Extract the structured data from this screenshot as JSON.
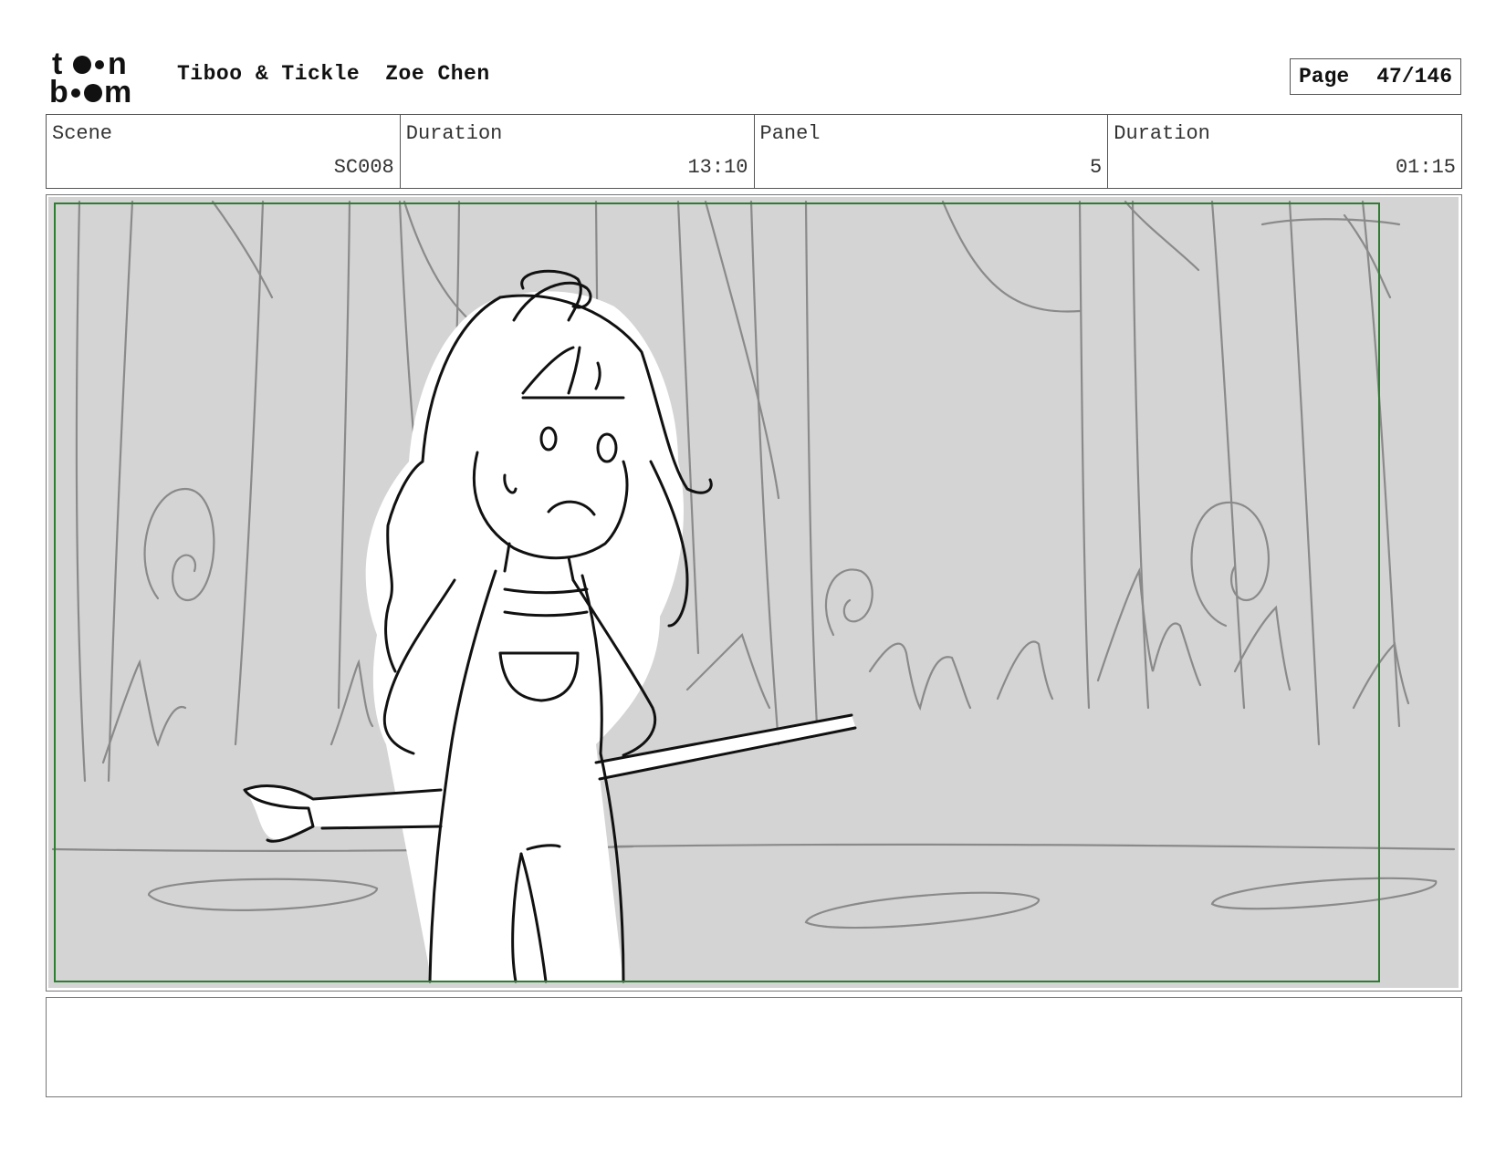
{
  "header": {
    "logo": {
      "name": "toon-boom-logo",
      "line1": "toon",
      "line2": "boom"
    },
    "project_title": "Tiboo & Tickle",
    "author": "Zoe Chen",
    "page_label": "Page",
    "page_number": "47/146"
  },
  "info": {
    "scene_label": "Scene",
    "scene_value": "SC008",
    "scene_duration_label": "Duration",
    "scene_duration_value": "13:10",
    "panel_label": "Panel",
    "panel_value": "5",
    "panel_duration_label": "Duration",
    "panel_duration_value": "01:15"
  },
  "panel": {
    "image": "storyboard-sketch-girl-in-forest",
    "colors": {
      "background": "#d4d4d4",
      "safe_frame": "#2e7d32",
      "sketch_bg": "#8a8a8a",
      "sketch_char": "#111111"
    }
  },
  "notes": {
    "text": ""
  }
}
